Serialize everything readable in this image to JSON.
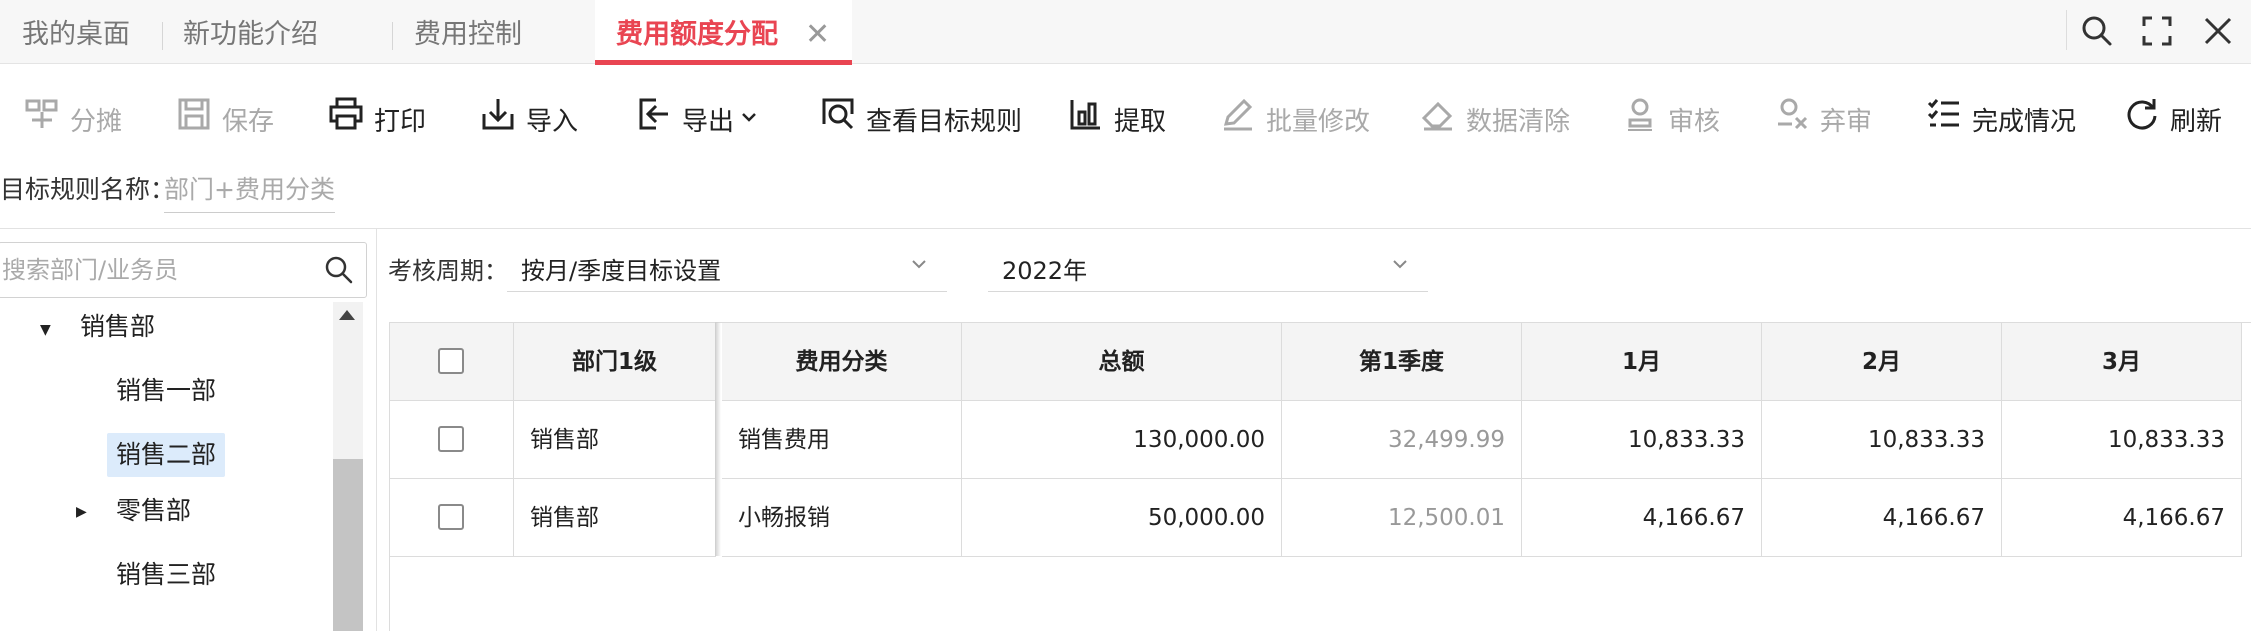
{
  "tabs": [
    {
      "label": "我的桌面"
    },
    {
      "label": "新功能介绍"
    },
    {
      "label": "费用控制"
    },
    {
      "label": "费用额度分配",
      "active": true
    }
  ],
  "colors": {
    "accent": "#e94552",
    "selected_bg": "#dcebfb",
    "disabled": "#a9a9a9"
  },
  "toolbar": [
    {
      "label": "分摊",
      "icon": "allocate-icon",
      "disabled": true
    },
    {
      "label": "保存",
      "icon": "save-icon",
      "disabled": true
    },
    {
      "label": "打印",
      "icon": "printer-icon",
      "disabled": false
    },
    {
      "label": "导入",
      "icon": "import-icon",
      "disabled": false
    },
    {
      "label": "导出",
      "icon": "export-icon",
      "disabled": false
    },
    {
      "label": "查看目标规则",
      "icon": "view-rule-icon",
      "disabled": false
    },
    {
      "label": "提取",
      "icon": "extract-icon",
      "disabled": false
    },
    {
      "label": "批量修改",
      "icon": "pencil-icon",
      "disabled": true
    },
    {
      "label": "数据清除",
      "icon": "eraser-icon",
      "disabled": true
    },
    {
      "label": "审核",
      "icon": "approve-icon",
      "disabled": true
    },
    {
      "label": "弃审",
      "icon": "unapprove-icon",
      "disabled": true
    },
    {
      "label": "完成情况",
      "icon": "checklist-icon",
      "disabled": false
    },
    {
      "label": "刷新",
      "icon": "refresh-icon",
      "disabled": false
    }
  ],
  "rule": {
    "label": "目标规则名称：",
    "value": "部门+费用分类"
  },
  "tree": {
    "search_placeholder": "搜索部门/业务员",
    "items": [
      {
        "label": "销售部",
        "level": 0,
        "expanded": true
      },
      {
        "label": "销售一部",
        "level": 1
      },
      {
        "label": "销售二部",
        "level": 1,
        "selected": true
      },
      {
        "label": "零售部",
        "level": 1,
        "collapsed": true
      },
      {
        "label": "销售三部",
        "level": 1
      }
    ]
  },
  "filters": {
    "period_label": "考核周期：",
    "period_value": "按月/季度目标设置",
    "year_value": "2022年"
  },
  "table": {
    "headers": [
      "部门1级",
      "费用分类",
      "总额",
      "第1季度",
      "1月",
      "2月",
      "3月"
    ],
    "rows": [
      {
        "dept": "销售部",
        "category": "销售费用",
        "total": "130,000.00",
        "q1": "32,499.99",
        "m1": "10,833.33",
        "m2": "10,833.33",
        "m3": "10,833.33"
      },
      {
        "dept": "销售部",
        "category": "小畅报销",
        "total": "50,000.00",
        "q1": "12,500.01",
        "m1": "4,166.67",
        "m2": "4,166.67",
        "m3": "4,166.67"
      }
    ]
  }
}
